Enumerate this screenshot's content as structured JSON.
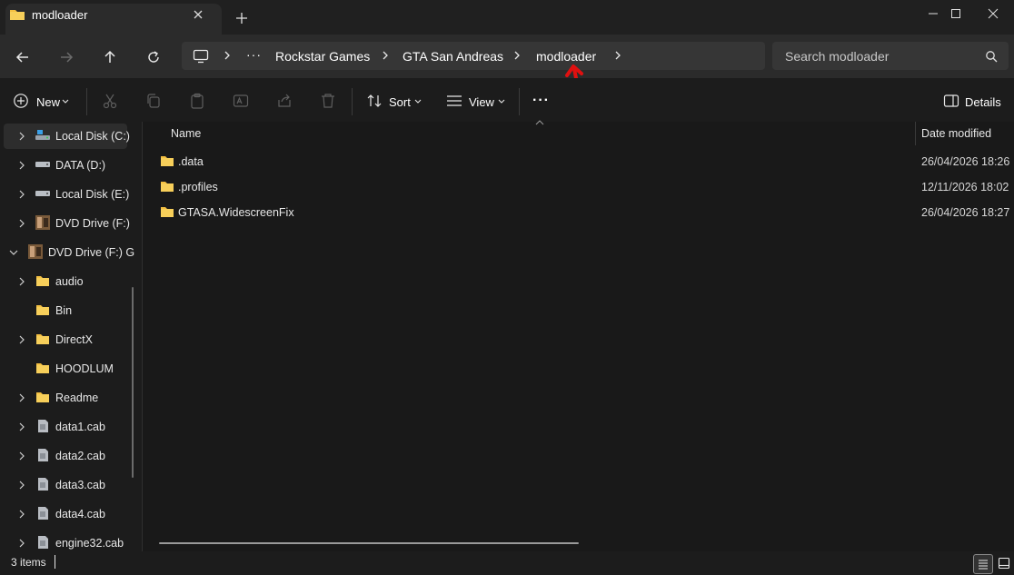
{
  "window": {
    "tab_title": "modloader",
    "new_tab": "+",
    "accent_folder_color": "#f4c042"
  },
  "address": {
    "ellipsis": "···",
    "crumbs": [
      "Rockstar Games",
      "GTA San Andreas",
      "modloader"
    ],
    "search_placeholder": "Search modloader"
  },
  "commands": {
    "new_label": "New",
    "sort_label": "Sort",
    "view_label": "View",
    "more_label": "···",
    "details_label": "Details"
  },
  "sidebar": {
    "items": [
      {
        "label": "Local Disk (C:)",
        "icon": "drive-c-icon",
        "expand": "collapsed"
      },
      {
        "label": "DATA (D:)",
        "icon": "drive-icon",
        "expand": "collapsed"
      },
      {
        "label": "Local Disk (E:)",
        "icon": "drive-icon",
        "expand": "collapsed"
      },
      {
        "label": "DVD Drive (F:)",
        "icon": "dvd-icon",
        "expand": "collapsed"
      },
      {
        "label": "DVD Drive (F:) G",
        "icon": "dvd-icon",
        "expand": "expanded"
      },
      {
        "label": "audio",
        "icon": "folder-icon",
        "expand": "collapsed"
      },
      {
        "label": "Bin",
        "icon": "folder-icon",
        "expand": "none"
      },
      {
        "label": "DirectX",
        "icon": "folder-icon",
        "expand": "collapsed"
      },
      {
        "label": "HOODLUM",
        "icon": "folder-icon",
        "expand": "none"
      },
      {
        "label": "Readme",
        "icon": "folder-icon",
        "expand": "collapsed"
      },
      {
        "label": "data1.cab",
        "icon": "cab-file-icon",
        "expand": "collapsed"
      },
      {
        "label": "data2.cab",
        "icon": "cab-file-icon",
        "expand": "collapsed"
      },
      {
        "label": "data3.cab",
        "icon": "cab-file-icon",
        "expand": "collapsed"
      },
      {
        "label": "data4.cab",
        "icon": "cab-file-icon",
        "expand": "collapsed"
      },
      {
        "label": "engine32.cab",
        "icon": "cab-file-icon",
        "expand": "collapsed"
      }
    ]
  },
  "columns": {
    "name": "Name",
    "date": "Date modified"
  },
  "files": [
    {
      "name": ".data",
      "date": "26/04/2026 18:26"
    },
    {
      "name": ".profiles",
      "date": "12/11/2026 18:02"
    },
    {
      "name": "GTASA.WidescreenFix",
      "date": "26/04/2026 18:27"
    }
  ],
  "status": {
    "count": "3 items"
  }
}
